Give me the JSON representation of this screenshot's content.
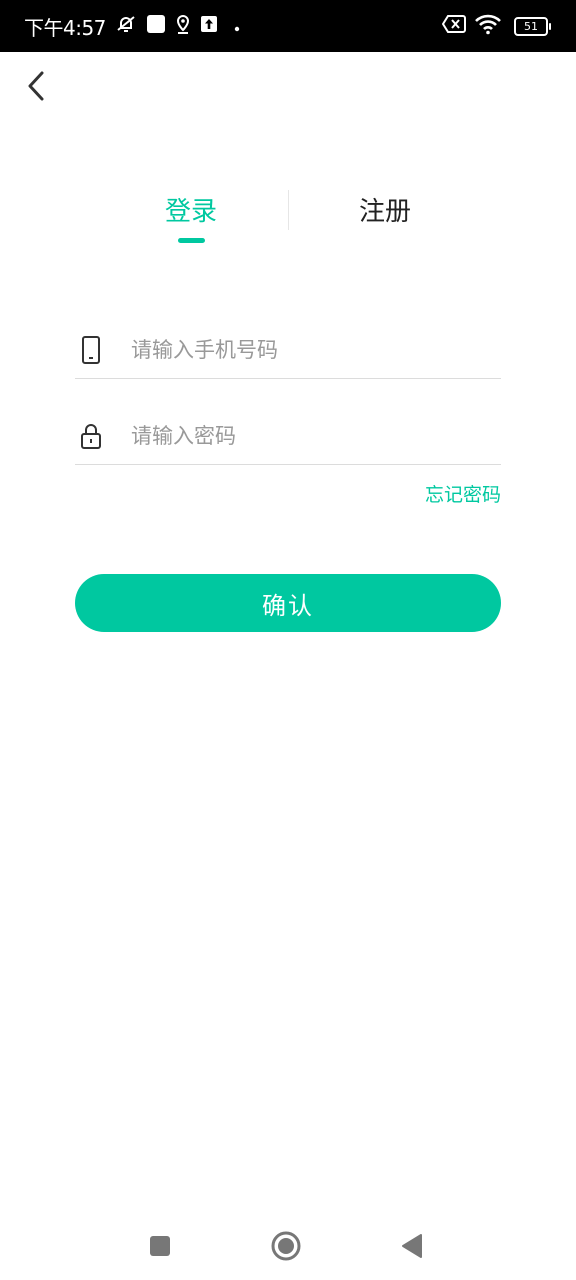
{
  "status_bar": {
    "time": "下午4:57",
    "battery": "51"
  },
  "tabs": [
    {
      "label": "登录",
      "active": true
    },
    {
      "label": "注册",
      "active": false
    }
  ],
  "form": {
    "phone": {
      "value": "",
      "placeholder": "请输入手机号码"
    },
    "password": {
      "value": "",
      "placeholder": "请输入密码"
    },
    "forgot_label": "忘记密码",
    "confirm_label": "确认"
  },
  "colors": {
    "accent": "#00c8a0",
    "text_dark": "#222222",
    "placeholder": "#999999",
    "divider": "#dcdcdc"
  },
  "icons": {
    "back": "chevron-left-icon",
    "phone": "mobile-phone-icon",
    "password": "lock-icon",
    "nav_recents": "square-icon",
    "nav_home": "circle-icon",
    "nav_back": "triangle-left-icon"
  }
}
